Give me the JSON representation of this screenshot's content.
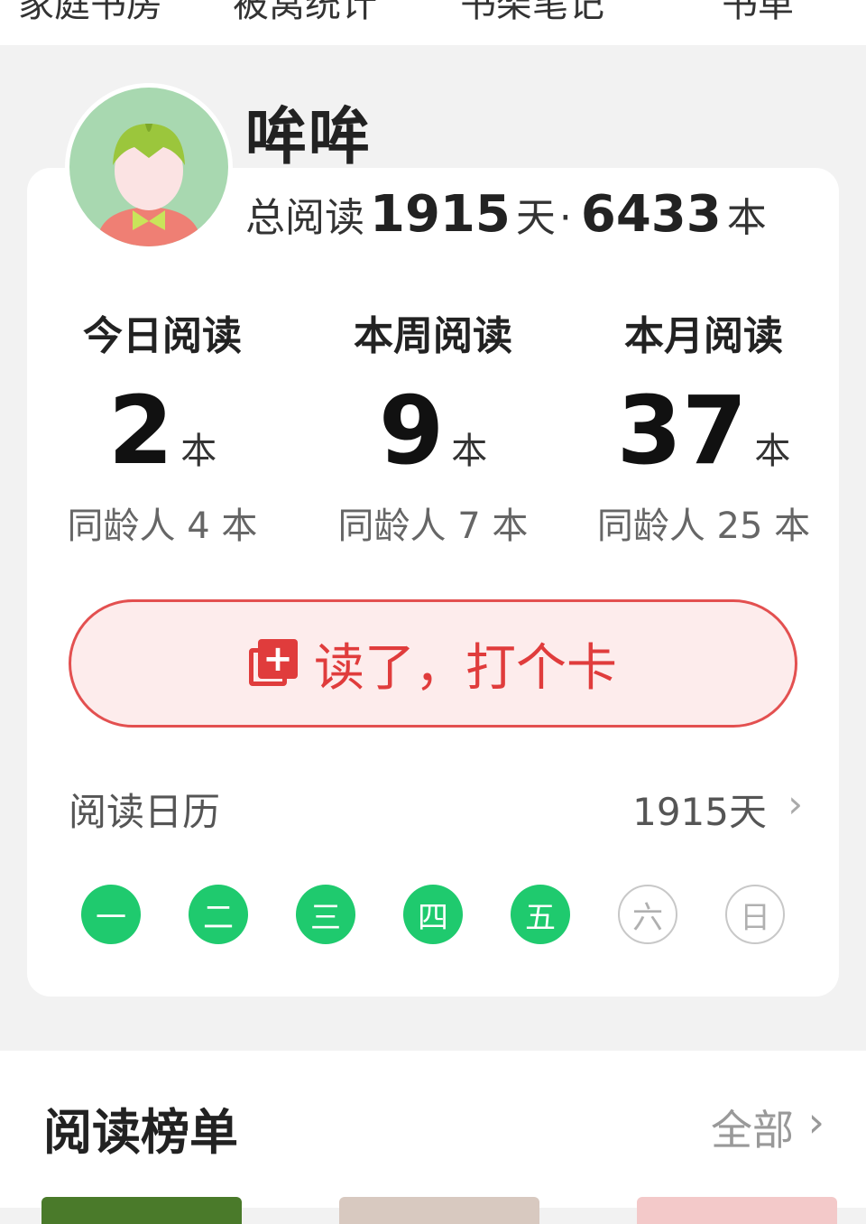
{
  "top_tabs": [
    "家庭书房",
    "被窝统计",
    "书架笔记",
    "书单"
  ],
  "profile": {
    "username": "哞哞",
    "total_prefix": "总阅读",
    "total_days": "1915",
    "days_unit": "天",
    "separator": "·",
    "total_books": "6433",
    "books_unit": "本"
  },
  "stats": [
    {
      "label": "今日阅读",
      "value": "2",
      "unit": "本",
      "peer": "同龄人 4 本"
    },
    {
      "label": "本周阅读",
      "value": "9",
      "unit": "本",
      "peer": "同龄人 7 本"
    },
    {
      "label": "本月阅读",
      "value": "37",
      "unit": "本",
      "peer": "同龄人 25 本"
    }
  ],
  "checkin": {
    "label": "读了，打个卡",
    "icon": "add-note-icon"
  },
  "calendar": {
    "title": "阅读日历",
    "days_text": "1915天",
    "week": [
      {
        "label": "一",
        "done": true
      },
      {
        "label": "二",
        "done": true
      },
      {
        "label": "三",
        "done": true
      },
      {
        "label": "四",
        "done": true
      },
      {
        "label": "五",
        "done": true
      },
      {
        "label": "六",
        "done": false
      },
      {
        "label": "日",
        "done": false
      }
    ]
  },
  "ranking": {
    "title": "阅读榜单",
    "all_label": "全部",
    "chevron": "chevron-right-icon"
  },
  "colors": {
    "accent_green": "#1fca6e",
    "accent_red": "#e03c3c",
    "checkin_bg": "#fdecec"
  }
}
